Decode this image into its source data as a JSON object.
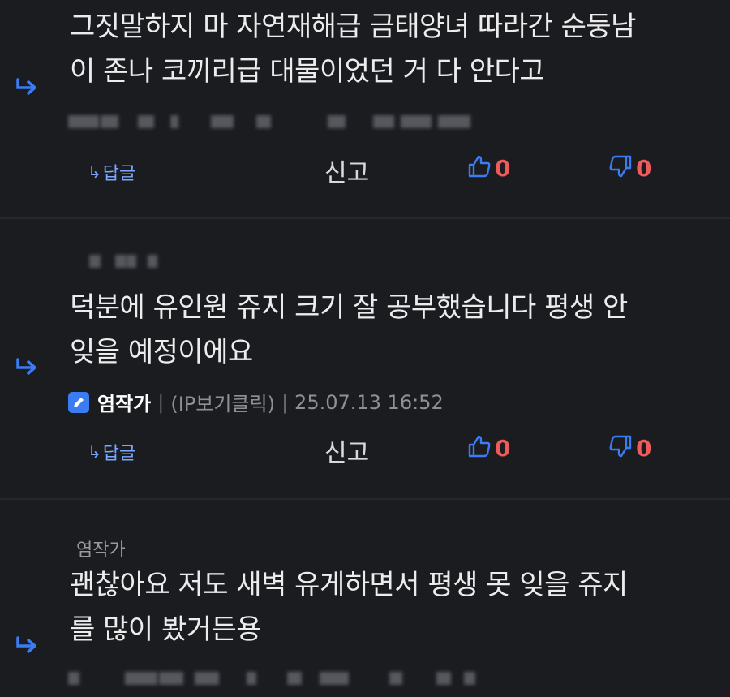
{
  "comments": [
    {
      "text": "그짓말하지 마 자연재해급 금태양녀 따라간 순둥남\n이 존나 코끼리급 대물이었던 거 다 안다고",
      "reply_label": "답글",
      "report_label": "신고",
      "likes": "0",
      "dislikes": "0"
    },
    {
      "text": "덕분에 유인원 쥬지 크기 잘 공부했습니다 평생 안\n잊을 예정이에요",
      "author": "염작가",
      "ip": "(IP보기클릭)",
      "timestamp": "25.07.13 16:52",
      "reply_label": "답글",
      "report_label": "신고",
      "likes": "0",
      "dislikes": "0"
    },
    {
      "nickname": "염작가",
      "text": "괜찮아요 저도 새벽 유게하면서 평생 못 잊을 쥬지\n를 많이 봤거든용"
    }
  ],
  "colors": {
    "background": "#1b1c20",
    "accent_blue": "#3b7cf5",
    "count_red": "#ef5a5a"
  }
}
